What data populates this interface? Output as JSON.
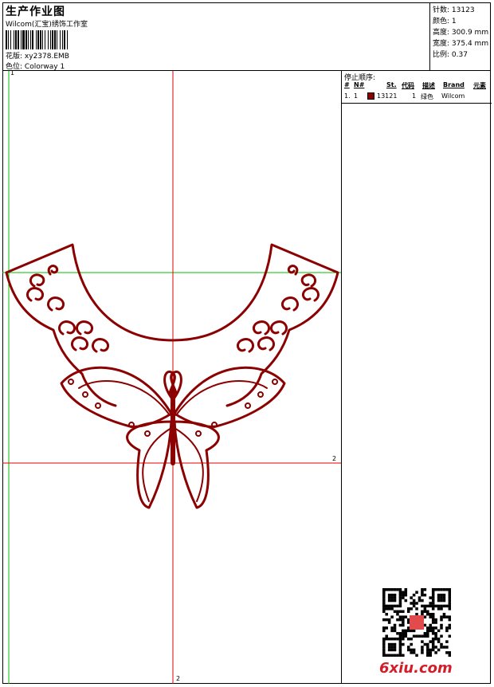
{
  "header": {
    "title": "生产作业图",
    "company": "Wilcom(汇宝)绣饰工作室",
    "design_label": "花版:",
    "design_value": "xy2378.EMB",
    "colorway_label": "色位:",
    "colorway_value": "Colorway 1"
  },
  "stats": {
    "stitches_label": "针数:",
    "stitches_value": "13123",
    "colors_label": "颜色:",
    "colors_value": "1",
    "height_label": "高度:",
    "height_value": "300.9 mm",
    "width_label": "宽度:",
    "width_value": "375.4 mm",
    "scale_label": "比例:",
    "scale_value": "0.37"
  },
  "stop_sequence": {
    "title": "停止顺序:",
    "columns": [
      "#",
      "N#",
      "St.",
      "代码",
      "描述",
      "Brand",
      "元素"
    ],
    "rows": [
      {
        "index": "1.",
        "needle": "1",
        "stitches": "13121",
        "code": "1",
        "description": "绿色",
        "brand": "Wilcom",
        "color": "#8b0000"
      }
    ]
  },
  "canvas": {
    "marker_top_left": "1",
    "marker_right": "2",
    "marker_bottom": "2",
    "thread_color": "#8b0000",
    "guide_green": "#00c000",
    "guide_red": "#e00000"
  },
  "logo": {
    "text": "6xiu.com",
    "color": "#d21e2b"
  }
}
